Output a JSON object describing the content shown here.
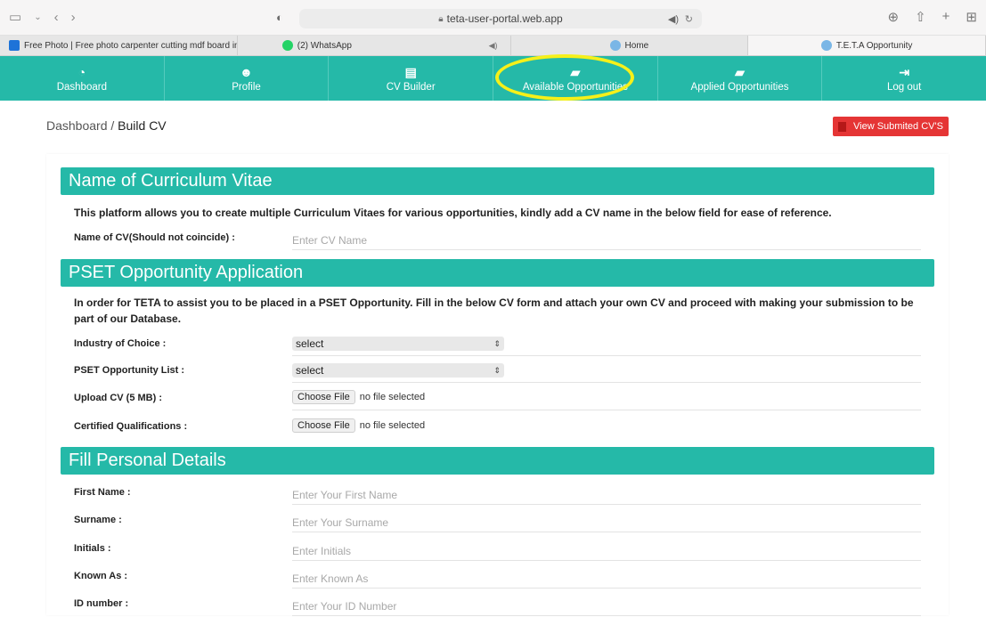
{
  "browser": {
    "url": "teta-user-portal.web.app",
    "tabs": [
      {
        "label": "Free Photo | Free photo carpenter cutting mdf board in…",
        "favicon_color": "#1e73d8"
      },
      {
        "label": "(2) WhatsApp",
        "favicon_color": "#25d366"
      },
      {
        "label": "Home",
        "favicon_color": "#7ab6e6"
      },
      {
        "label": "T.E.T.A Opportunity",
        "favicon_color": "#7ab6e6"
      }
    ]
  },
  "nav": {
    "items": [
      {
        "label": "Dashboard",
        "icon": "dashboard-icon"
      },
      {
        "label": "Profile",
        "icon": "user-icon"
      },
      {
        "label": "CV Builder",
        "icon": "document-icon"
      },
      {
        "label": "Available Opportunities",
        "icon": "briefcase-icon"
      },
      {
        "label": "Applied Opportunities",
        "icon": "briefcase-icon"
      },
      {
        "label": "Log out",
        "icon": "logout-icon"
      }
    ],
    "highlight_color": "#f6f01a",
    "accent": "#25b9a8"
  },
  "breadcrumb": {
    "parent": "Dashboard",
    "separator": " / ",
    "current": "Build CV"
  },
  "view_button": {
    "label": "View Submited CV'S",
    "color": "#e53535"
  },
  "sections": {
    "cv_name": {
      "title": "Name of Curriculum Vitae",
      "description": "This platform allows you to create multiple Curriculum Vitaes for various opportunities, kindly add a CV name in the below field for ease of reference.",
      "field_label": "Name of CV(Should not coincide) :",
      "field_placeholder": "Enter CV Name"
    },
    "pset": {
      "title": "PSET Opportunity Application",
      "description": "In order for TETA to assist you to be placed in a PSET Opportunity. Fill in the below CV form and attach your own CV and proceed with making your submission to be part of our Database.",
      "industry_label": "Industry of Choice :",
      "industry_value": "select",
      "list_label": "PSET Opportunity List :",
      "list_value": "select",
      "upload_label": "Upload CV (5 MB) :",
      "cert_label": "Certified Qualifications :",
      "choose_file": "Choose File",
      "no_file": "no file selected"
    },
    "personal": {
      "title": "Fill Personal Details",
      "fields": [
        {
          "label": "First Name :",
          "placeholder": "Enter Your First Name"
        },
        {
          "label": "Surname :",
          "placeholder": "Enter Your Surname"
        },
        {
          "label": "Initials :",
          "placeholder": "Enter Initials"
        },
        {
          "label": "Known As :",
          "placeholder": "Enter Known As"
        },
        {
          "label": "ID number :",
          "placeholder": "Enter Your ID Number"
        }
      ]
    }
  }
}
